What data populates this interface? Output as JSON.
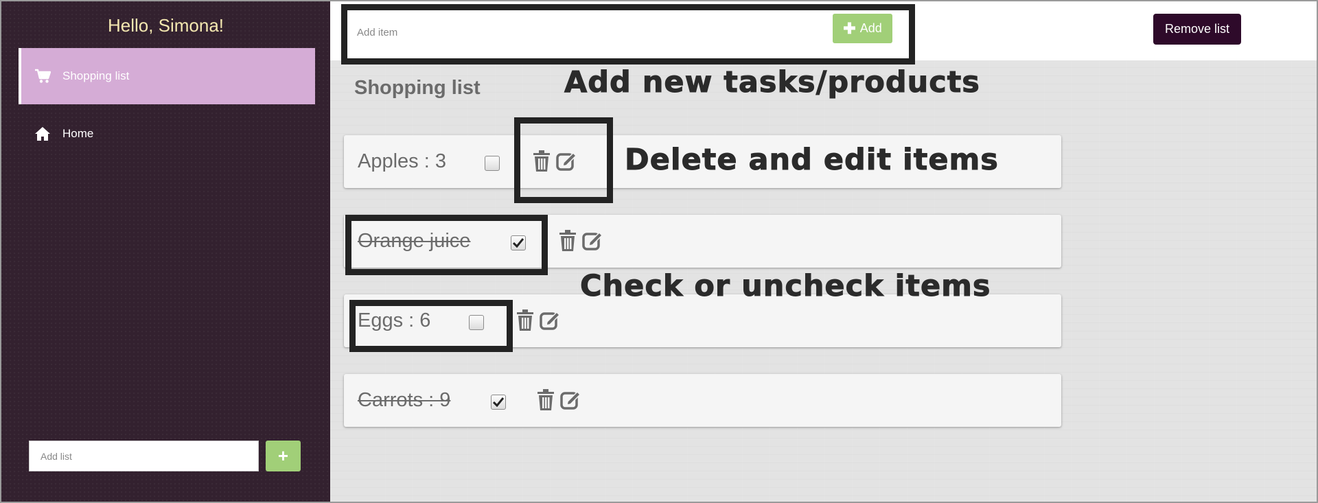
{
  "sidebar": {
    "greeting": "Hello, Simona!",
    "items": [
      {
        "label": "Shopping list",
        "icon": "cart-icon",
        "active": true
      },
      {
        "label": "Home",
        "icon": "home-icon",
        "active": false
      }
    ],
    "add_list_placeholder": "Add list",
    "add_list_button": "+"
  },
  "header": {
    "add_item_placeholder": "Add item",
    "add_button_label": "Add",
    "remove_list_label": "Remove list"
  },
  "list": {
    "title": "Shopping list",
    "items": [
      {
        "text": "Apples : 3",
        "checked": false
      },
      {
        "text": "Orange juice ",
        "checked": true
      },
      {
        "text": "Eggs : 6",
        "checked": false
      },
      {
        "text": "Carrots : 9 ",
        "checked": true
      }
    ]
  },
  "annotations": {
    "add": "Add new tasks/products",
    "delete_edit": "Delete and edit items",
    "check": "Check  or uncheck items"
  },
  "colors": {
    "sidebar_bg": "#33212f",
    "active_item_bg": "#d5acd6",
    "add_button": "#a1cf78",
    "remove_button": "#2e0a2a",
    "greeting_text": "#f3e7b0"
  }
}
